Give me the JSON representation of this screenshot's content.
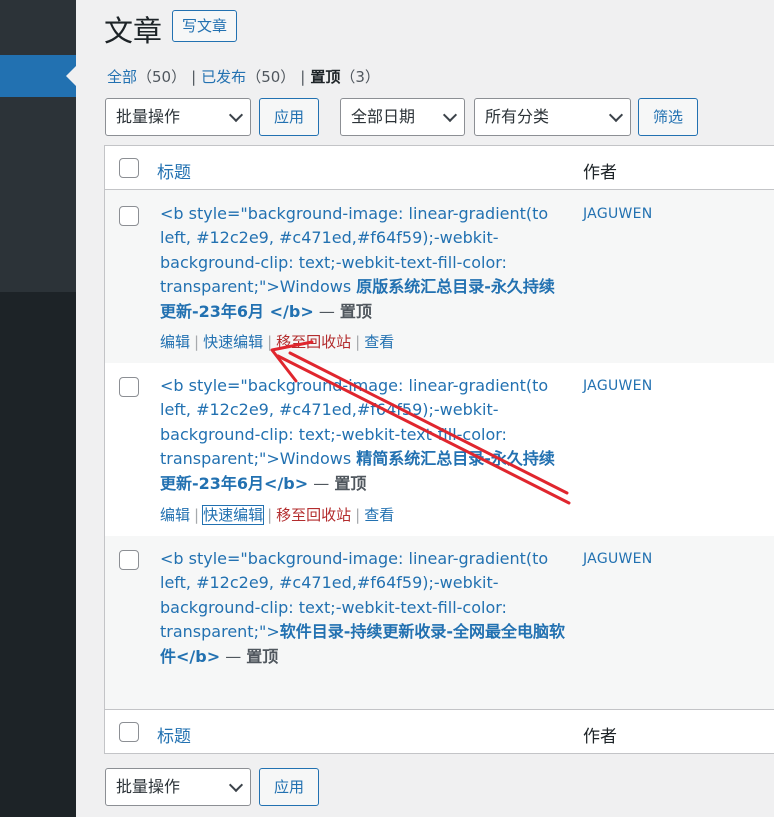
{
  "page": {
    "title": "文章",
    "add_new_label": "写文章"
  },
  "views": {
    "all_label": "全部",
    "all_count": "（50）",
    "published_label": "已发布",
    "published_count": "（50）",
    "sticky_label": "置顶",
    "sticky_count": "（3）",
    "separator": "|"
  },
  "filters": {
    "bulk_action": "批量操作",
    "apply_label": "应用",
    "date_filter": "全部日期",
    "category_filter": "所有分类",
    "filter_label": "筛选"
  },
  "table": {
    "col_title": "标题",
    "col_author": "作者",
    "rows": [
      {
        "title_code": "<b style=\"background-image: linear-gradient(to left, #12c2e9, #c471ed,#f64f59);-webkit-background-clip: text;-webkit-text-fill-color: transparent;\">Windows ",
        "title_strong": "原版系统汇总目录-永久持续更新-23年6月",
        "title_end": " </b>",
        "dash": " — ",
        "state": "置顶",
        "author": "JAGUWEN"
      },
      {
        "title_code": "<b style=\"background-image: linear-gradient(to left, #12c2e9, #c471ed,#f64f59);-webkit-background-clip: text;-webkit-text-fill-color: transparent;\">Windows ",
        "title_strong": "精简系统汇总目录-永久持续更新-23年6月",
        "title_end": "</b>",
        "dash": " — ",
        "state": "置顶",
        "author": "JAGUWEN"
      },
      {
        "title_code": "<b style=\"background-image: linear-gradient(to left, #12c2e9, #c471ed,#f64f59);-webkit-background-clip: text;-webkit-text-fill-color: transparent;\">",
        "title_strong": "软件目录-持续更新收录-全网最全电脑软件",
        "title_end": "</b>",
        "dash": " — ",
        "state": "置顶",
        "author": "JAGUWEN"
      }
    ],
    "row_actions": {
      "edit": "编辑",
      "quick_edit": "快速编辑",
      "trash": "移至回收站",
      "view": "查看",
      "pipe": "|"
    }
  },
  "footer_filters": {
    "bulk_action": "批量操作",
    "apply_label": "应用"
  },
  "colors": {
    "link": "#2271b1",
    "trash": "#b32d2e",
    "annotation_arrow": "#e0262e"
  }
}
